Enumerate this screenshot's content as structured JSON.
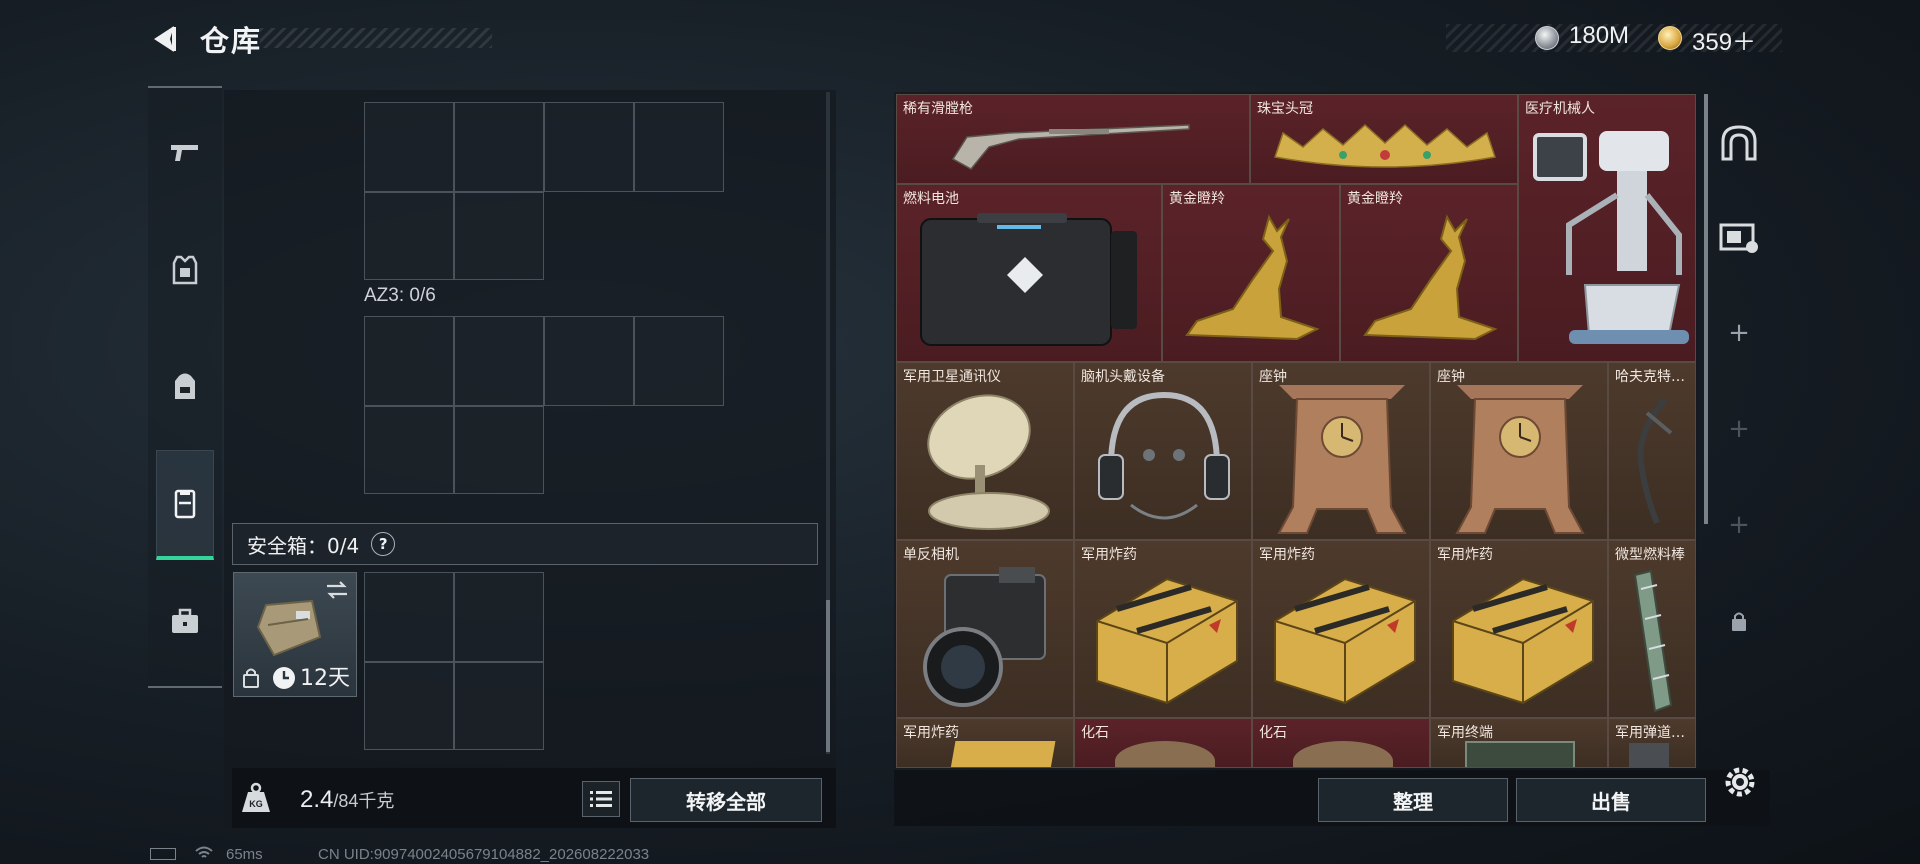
{
  "header": {
    "title": "仓库",
    "currency": {
      "silver": "180M",
      "gold": "359＋"
    }
  },
  "left_nav": {
    "items": [
      "weapon",
      "armor",
      "backpack",
      "safebox",
      "case"
    ],
    "active": "safebox"
  },
  "storage": {
    "az3_label": "AZ3: 0/6",
    "safebox_label": "安全箱：0/4",
    "help": "?",
    "safebox_days": "12天"
  },
  "footer_left": {
    "weight": "2.4",
    "weight_max": "/84千克",
    "weight_badge": "KG",
    "transfer_all": "转移全部"
  },
  "items": [
    "稀有滑膛枪",
    "珠宝头冠",
    "医疗机械人",
    "燃料电池",
    "黄金瞪羚",
    "黄金瞪羚",
    "军用卫星通讯仪",
    "脑机头戴设备",
    "座钟",
    "座钟",
    "哈夫克特…",
    "单反相机",
    "军用炸药",
    "军用炸药",
    "军用炸药",
    "微型燃料棒",
    "军用炸药",
    "化石",
    "化石",
    "军用终端",
    "军用弹道…"
  ],
  "footer_right": {
    "sort": "整理",
    "sell": "出售"
  },
  "status_bar": {
    "ping": "65ms",
    "uid": "CN UID:9097400240567910​4882_202608222033"
  },
  "colors": {
    "accent_green": "#35d49a",
    "rare_red": "#4a1c21",
    "epic_brown": "#3d2e23"
  }
}
